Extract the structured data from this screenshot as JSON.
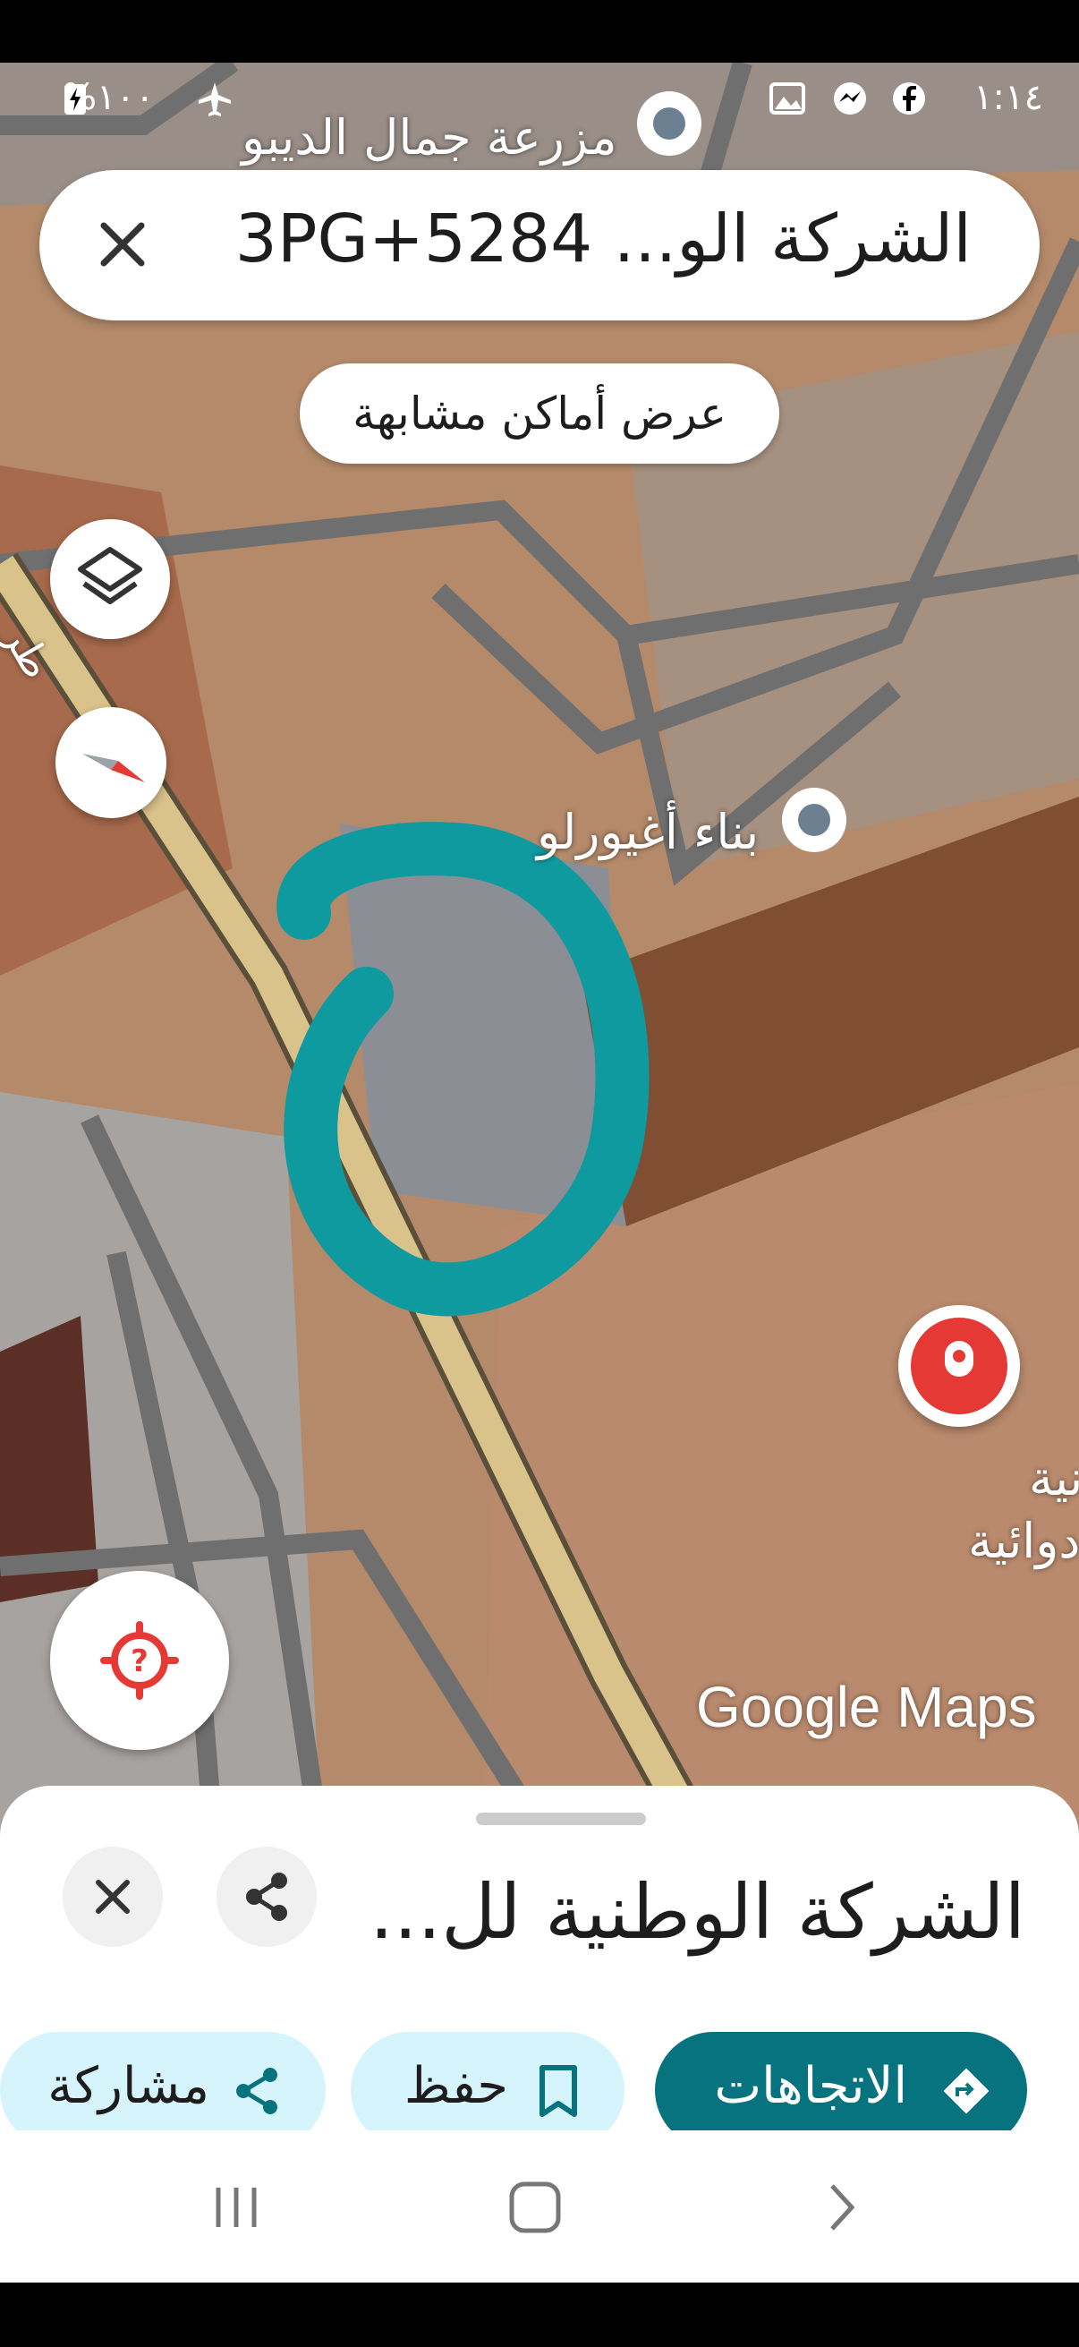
{
  "status_bar": {
    "time": "١:١٤",
    "battery": "%١٠٠"
  },
  "search": {
    "query": "الشركة الو... 5284+3PG"
  },
  "chips": {
    "similar_places": "عرض أماكن مشابهة"
  },
  "map": {
    "labels": {
      "farm": "مزرعة جمال الديبو",
      "building": "بناء أغيورلو",
      "road_label": "طر",
      "partial_1": "نية",
      "partial_2": "دوائية"
    },
    "attribution": "Google Maps",
    "circle_color": "#0f9a9f",
    "pin_color": "#e53935"
  },
  "sheet": {
    "title": "الشركة الوطنية لل...",
    "actions": {
      "directions": "الاتجاهات",
      "save": "حفظ",
      "share": "مشاركة"
    }
  },
  "colors": {
    "primary": "#07737f",
    "chip": "#d6f4fb"
  }
}
